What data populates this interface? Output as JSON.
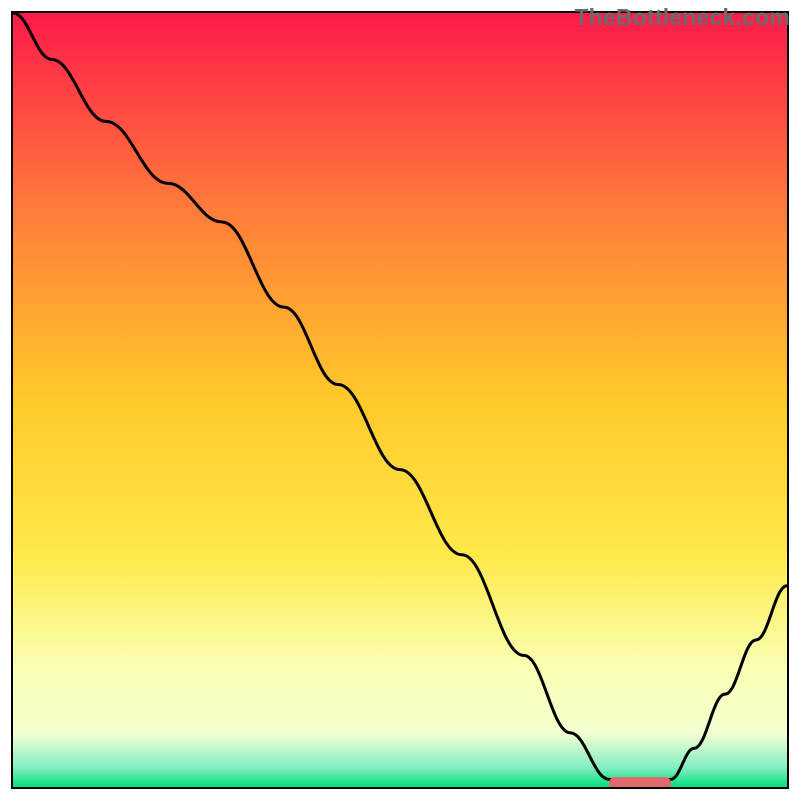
{
  "watermark": "TheBottleneck.com",
  "colors": {
    "gradient_top": "#ff1a4a",
    "gradient_mid1": "#ff7a3a",
    "gradient_mid2": "#ffca2a",
    "gradient_mid3": "#ffe84a",
    "gradient_mid4": "#faffb0",
    "gradient_bottom_yellow": "#f4ffd0",
    "gradient_bottom_green": "#00e07a",
    "frame_border": "#000000",
    "curve_stroke": "#000000",
    "highlight_fill": "#e16a6a"
  },
  "chart_data": {
    "type": "line",
    "title": "",
    "xlabel": "",
    "ylabel": "",
    "xlim": [
      0,
      100
    ],
    "ylim": [
      0,
      100
    ],
    "grid": false,
    "legend": false,
    "series": [
      {
        "name": "curve",
        "x": [
          0,
          5,
          12,
          20,
          27,
          35,
          42,
          50,
          58,
          66,
          72,
          77,
          80,
          82,
          85,
          88,
          92,
          96,
          100
        ],
        "y": [
          100,
          94,
          86,
          78,
          73,
          62,
          52,
          41,
          30,
          17,
          7,
          1,
          0,
          0,
          1,
          5,
          12,
          19,
          26
        ]
      }
    ],
    "annotations": [
      {
        "name": "highlight-region",
        "x_start": 77,
        "x_end": 85,
        "y": 0.5
      }
    ],
    "background_gradient_stops": [
      {
        "pos": 0.0,
        "color": "#ff1a4a"
      },
      {
        "pos": 0.25,
        "color": "#ff7a3a"
      },
      {
        "pos": 0.5,
        "color": "#ffca2a"
      },
      {
        "pos": 0.7,
        "color": "#ffe84a"
      },
      {
        "pos": 0.84,
        "color": "#faffb0"
      },
      {
        "pos": 0.93,
        "color": "#f4ffd0"
      },
      {
        "pos": 0.975,
        "color": "#83eec3"
      },
      {
        "pos": 1.0,
        "color": "#00e07a"
      }
    ]
  }
}
